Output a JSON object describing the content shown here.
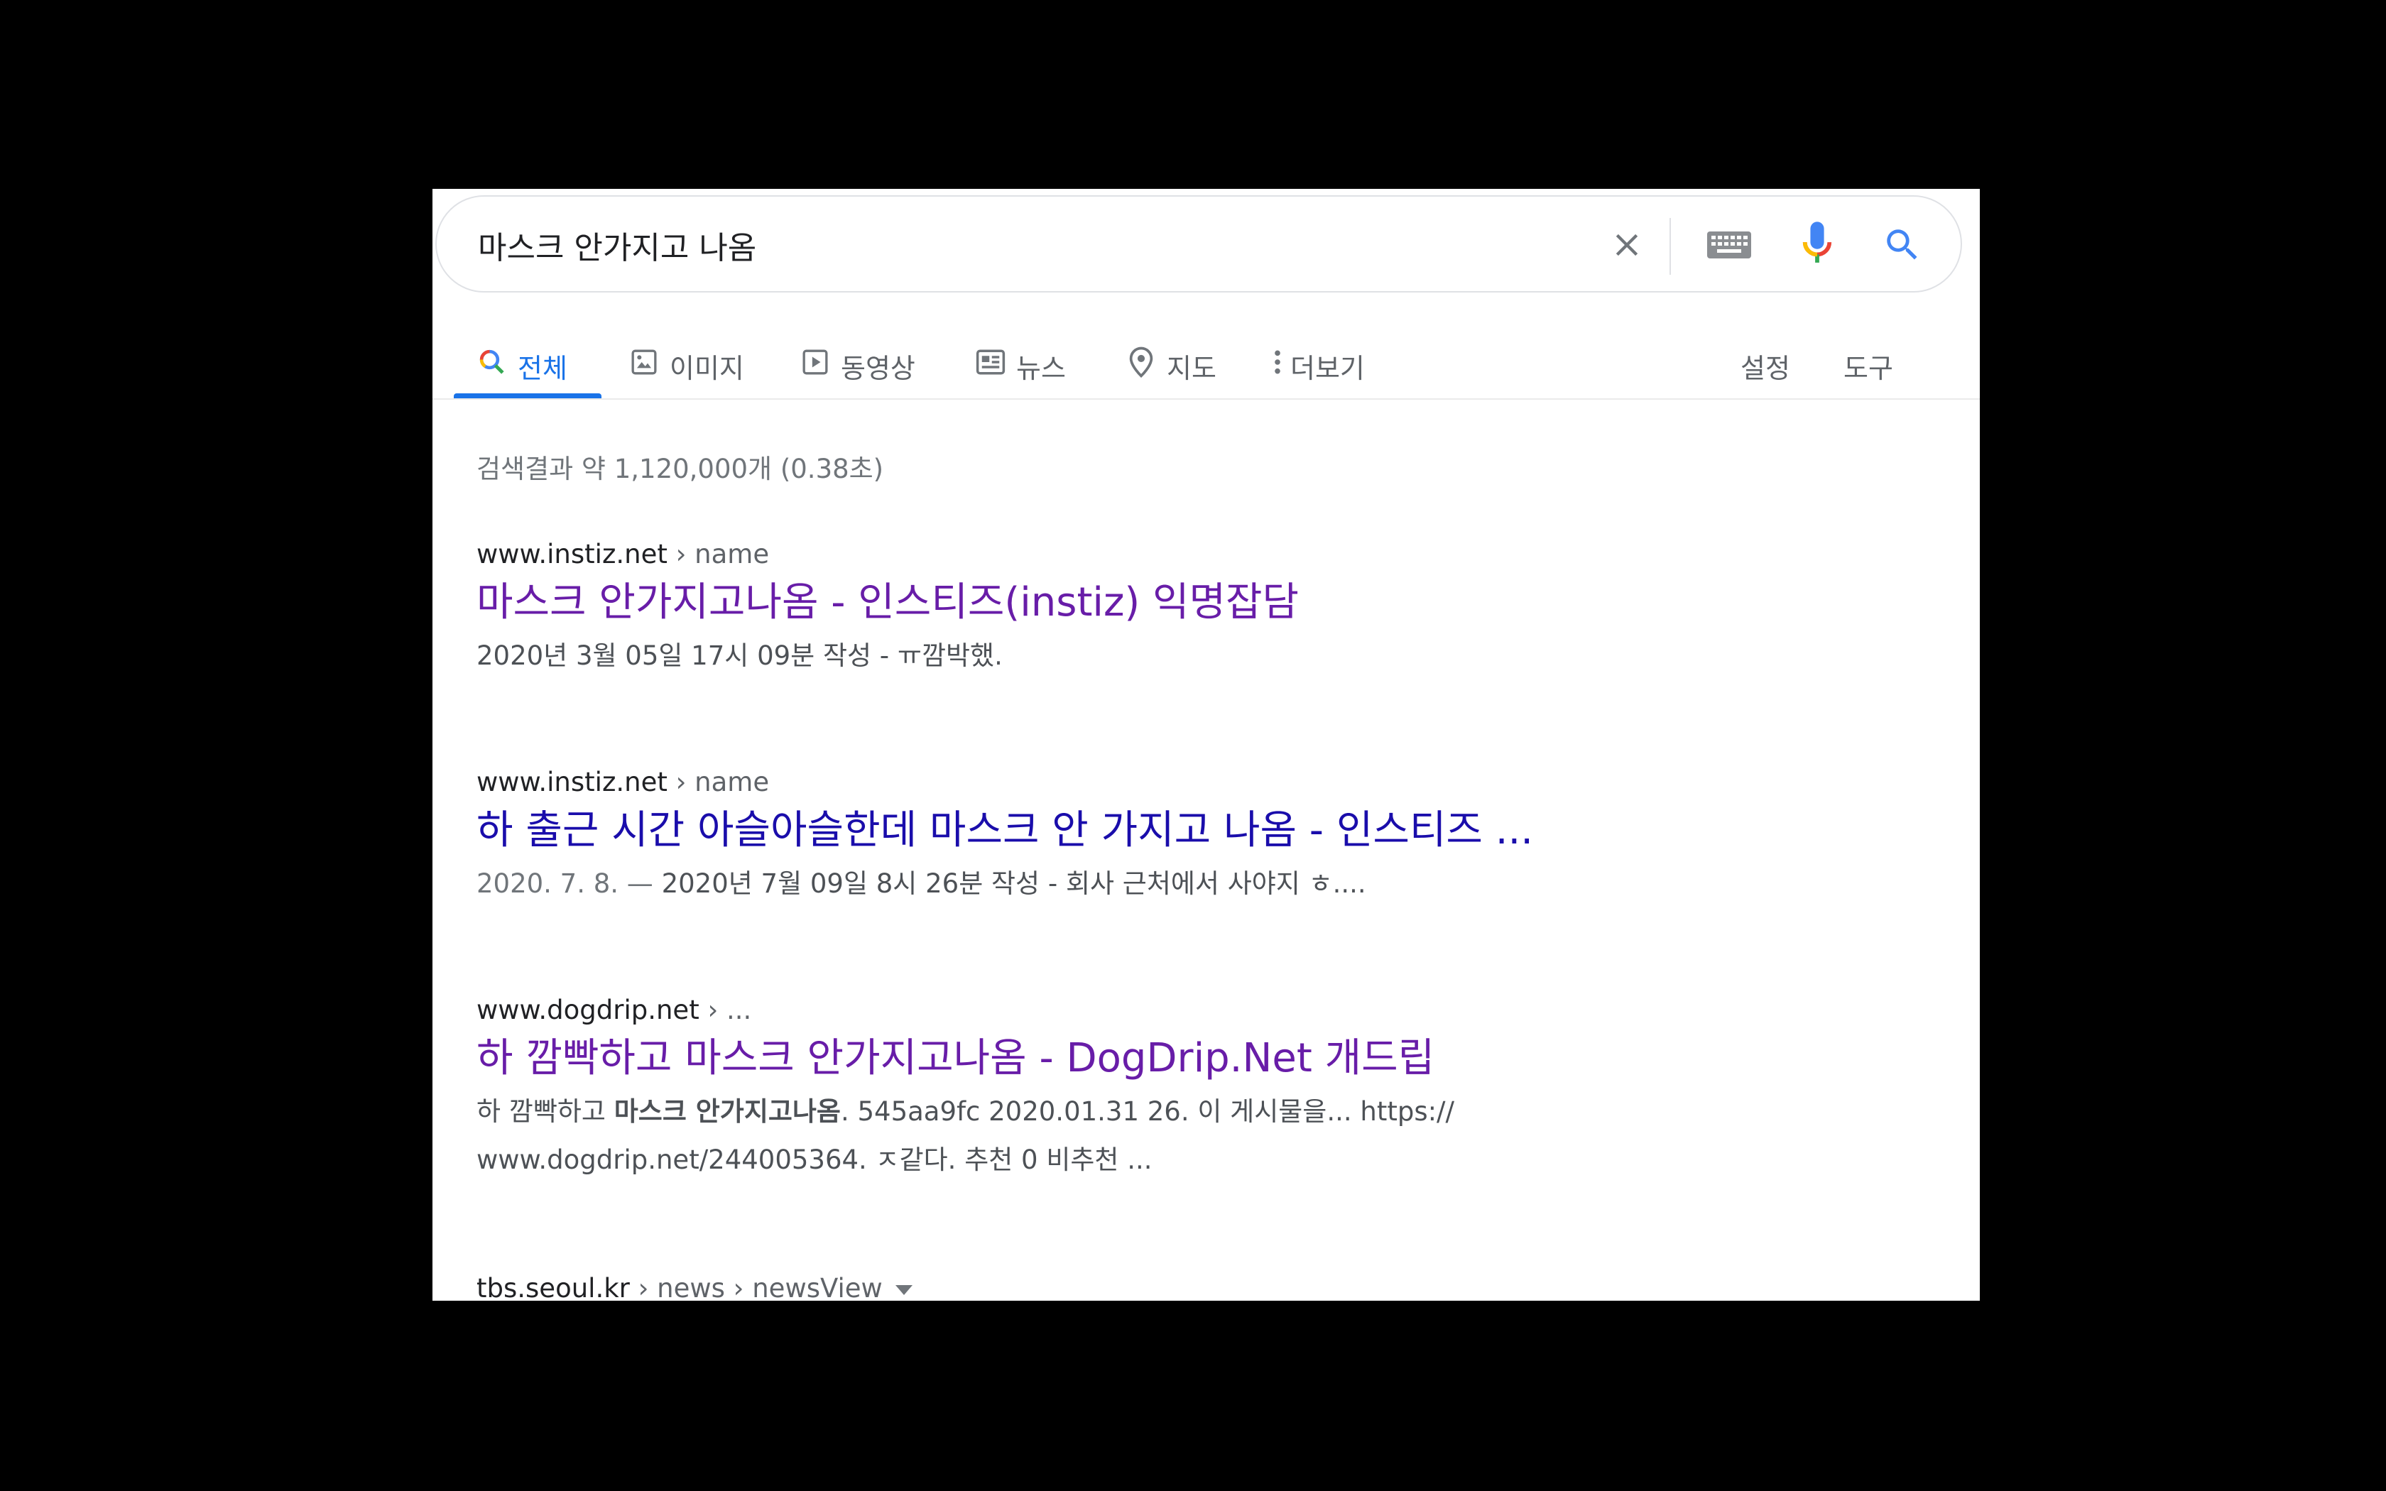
{
  "search": {
    "query": "마스크 안가지고 나옴"
  },
  "icons": {
    "clear": "close-icon",
    "keyboard": "keyboard-icon",
    "voice": "microphone-icon",
    "search": "search-icon"
  },
  "tabs": [
    {
      "label": "전체",
      "icon": "search-icon",
      "active": true
    },
    {
      "label": "이미지",
      "icon": "image-icon"
    },
    {
      "label": "동영상",
      "icon": "video-icon"
    },
    {
      "label": "뉴스",
      "icon": "news-icon"
    },
    {
      "label": "지도",
      "icon": "map-pin-icon"
    },
    {
      "label": "더보기",
      "icon": "more-vert-icon"
    }
  ],
  "tools": {
    "settings": "설정",
    "tools": "도구"
  },
  "stats": "검색결과 약 1,120,000개 (0.38초)",
  "results": [
    {
      "domain": "www.instiz.net",
      "path": " › name",
      "title": "마스크 안가지고나옴 - 인스티즈(instiz) 익명잡담",
      "snippet": "2020년 3월 05일 17시 09분 작성 - ㅠ깜박했."
    },
    {
      "domain": "www.instiz.net",
      "path": " › name",
      "title": "하 출근 시간 아슬아슬한데 마스크 안 가지고 나옴 - 인스티즈 ...",
      "snippet_date": "2020. 7. 8. — ",
      "snippet": "2020년 7월 09일 8시 26분 작성 - 회사 근처에서 사야지 ㅎ...."
    },
    {
      "domain": "www.dogdrip.net",
      "path": " › ...",
      "title": "하 깜빡하고 마스크 안가지고나옴 - DogDrip.Net 개드립",
      "snippet_pre": "하 깜빡하고 ",
      "snippet_bold": "마스크 안가지고나옴",
      "snippet_post": ". 545aa9fc 2020.01.31 26. 이 게시물을... https://",
      "snippet_line2": "www.dogdrip.net/244005364. ㅈ같다. 추천 0 비추천 ..."
    },
    {
      "domain": "tbs.seoul.kr",
      "path": " › news › newsView"
    }
  ],
  "colors": {
    "link_visited": "#681da8",
    "link_unvisited": "#1a0dab",
    "accent": "#1a73e8"
  }
}
